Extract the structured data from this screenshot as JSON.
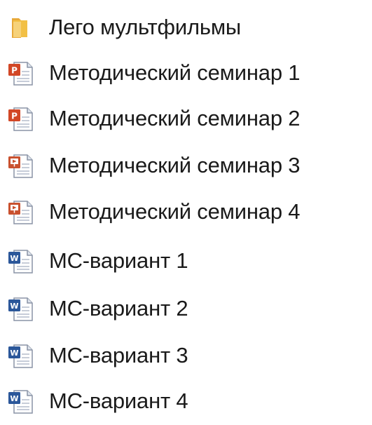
{
  "items": [
    {
      "name": "Лего мультфильмы",
      "icon": "folder-icon"
    },
    {
      "name": "Методический семинар 1",
      "icon": "powerpoint-file-icon"
    },
    {
      "name": "Методический семинар 2",
      "icon": "powerpoint-file-icon"
    },
    {
      "name": "Методический семинар 3",
      "icon": "powerpoint-show-file-icon"
    },
    {
      "name": "Методический семинар 4",
      "icon": "powerpoint-show-file-icon"
    },
    {
      "name": "МС-вариант 1",
      "icon": "word-file-icon"
    },
    {
      "name": "МС-вариант 2",
      "icon": "word-file-icon"
    },
    {
      "name": "МС-вариант 3",
      "icon": "word-file-icon"
    },
    {
      "name": "МС-вариант 4",
      "icon": "word-file-icon"
    }
  ],
  "colors": {
    "folder": "#f2c045",
    "powerpoint": "#d24726",
    "powerpoint_show": "#c9512f",
    "word": "#2b579a"
  }
}
